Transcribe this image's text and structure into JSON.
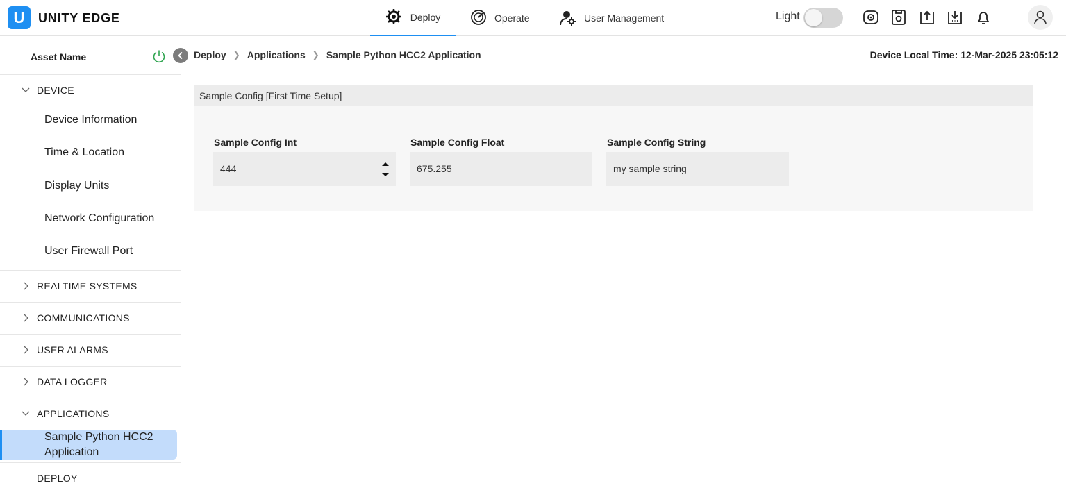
{
  "app": {
    "logo_letter": "U",
    "brand": "UNITY EDGE"
  },
  "nav": [
    {
      "label": "Deploy",
      "icon": "deploy-icon",
      "active": true
    },
    {
      "label": "Operate",
      "icon": "gauge-icon"
    },
    {
      "label": "User Management",
      "icon": "user-settings-icon"
    }
  ],
  "theme": {
    "label": "Light",
    "enabled": false
  },
  "colors": {
    "accent": "#1e8ff2",
    "active_bg": "#c3dcfb",
    "power": "#2ea44f"
  },
  "sidebar": {
    "asset_name": "Asset Name",
    "groups": {
      "device": "DEVICE",
      "realtime": "REALTIME SYSTEMS",
      "communications": "COMMUNICATIONS",
      "user_alarms": "USER ALARMS",
      "data_logger": "DATA LOGGER",
      "applications": "APPLICATIONS",
      "deploy": "DEPLOY"
    },
    "device_items": [
      "Device Information",
      "Time & Location",
      "Display Units",
      "Network Configuration",
      "User Firewall Port"
    ],
    "applications_items": [
      "Sample Python HCC2 Application"
    ]
  },
  "breadcrumb": [
    "Deploy",
    "Applications",
    "Sample Python HCC2 Application"
  ],
  "local_time": "Device Local Time: 12-Mar-2025 23:05:12",
  "panel": {
    "title": "Sample Config [First Time Setup]",
    "fields": [
      {
        "label": "Sample Config Int",
        "value": "444"
      },
      {
        "label": "Sample Config Float",
        "value": "675.255"
      },
      {
        "label": "Sample Config String",
        "value": "my sample string"
      }
    ]
  }
}
